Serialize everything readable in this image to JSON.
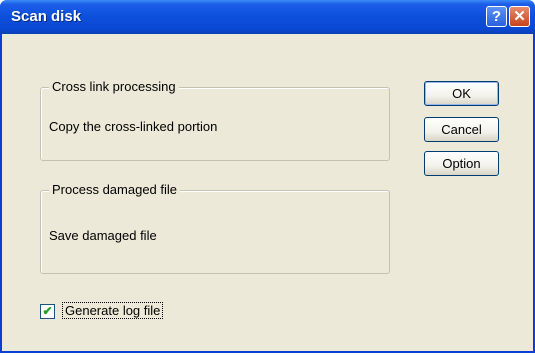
{
  "window": {
    "title": "Scan disk",
    "help_label": "?",
    "close_label": "✕"
  },
  "groups": [
    {
      "legend": "Cross link processing",
      "value": "Copy the cross-linked portion"
    },
    {
      "legend": "Process damaged file",
      "value": "Save damaged file"
    }
  ],
  "buttons": {
    "ok": "OK",
    "cancel": "Cancel",
    "option": "Option"
  },
  "log_option": {
    "label": "Generate log file",
    "checked": true,
    "check_glyph": "✔"
  },
  "colors": {
    "titlebar": "#0a48d3",
    "dialog_bg": "#ece9d8"
  }
}
